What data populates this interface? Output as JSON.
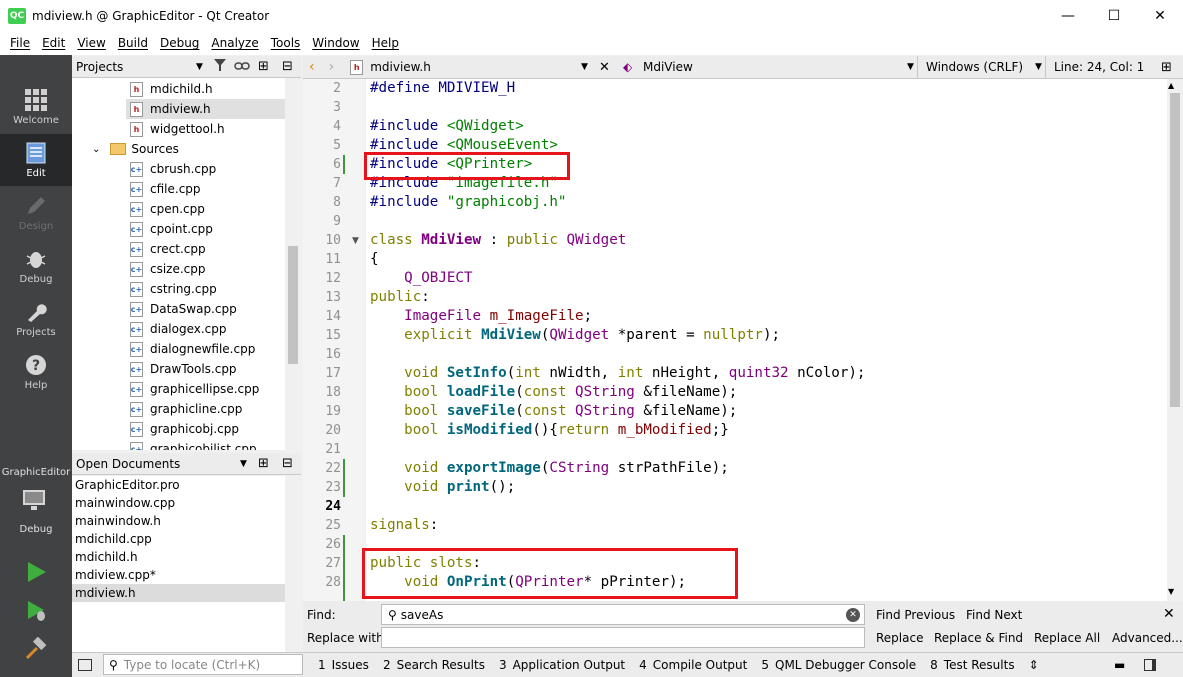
{
  "window": {
    "title": "mdiview.h @ GraphicEditor - Qt Creator",
    "logo": "QC",
    "minimize": "—",
    "maximize": "☐",
    "close": "✕"
  },
  "menu": [
    "File",
    "Edit",
    "View",
    "Build",
    "Debug",
    "Analyze",
    "Tools",
    "Window",
    "Help"
  ],
  "modes": [
    {
      "label": "Welcome",
      "icon": "grid-icon"
    },
    {
      "label": "Edit",
      "icon": "document-icon"
    },
    {
      "label": "Design",
      "icon": "pencil-icon"
    },
    {
      "label": "Debug",
      "icon": "bug-icon"
    },
    {
      "label": "Projects",
      "icon": "wrench-icon"
    },
    {
      "label": "Help",
      "icon": "help-icon"
    }
  ],
  "sidebar": {
    "project_name": "GraphicEditor",
    "project_sub": "Debug"
  },
  "projects": {
    "header": "Projects",
    "tree": [
      {
        "name": "mdichild.h",
        "type": "h"
      },
      {
        "name": "mdiview.h",
        "type": "h",
        "selected": true
      },
      {
        "name": "widgettool.h",
        "type": "h"
      },
      {
        "name": "Sources",
        "type": "folder"
      },
      {
        "name": "cbrush.cpp",
        "type": "cpp"
      },
      {
        "name": "cfile.cpp",
        "type": "cpp"
      },
      {
        "name": "cpen.cpp",
        "type": "cpp"
      },
      {
        "name": "cpoint.cpp",
        "type": "cpp"
      },
      {
        "name": "crect.cpp",
        "type": "cpp"
      },
      {
        "name": "csize.cpp",
        "type": "cpp"
      },
      {
        "name": "cstring.cpp",
        "type": "cpp"
      },
      {
        "name": "DataSwap.cpp",
        "type": "cpp"
      },
      {
        "name": "dialogex.cpp",
        "type": "cpp"
      },
      {
        "name": "dialognewfile.cpp",
        "type": "cpp"
      },
      {
        "name": "DrawTools.cpp",
        "type": "cpp"
      },
      {
        "name": "graphicellipse.cpp",
        "type": "cpp"
      },
      {
        "name": "graphicline.cpp",
        "type": "cpp"
      },
      {
        "name": "graphicobj.cpp",
        "type": "cpp"
      },
      {
        "name": "graphicobjlist.cpp",
        "type": "cpp"
      }
    ]
  },
  "open_documents": {
    "header": "Open Documents",
    "items": [
      "GraphicEditor.pro",
      "mainwindow.cpp",
      "mainwindow.h",
      "mdichild.cpp",
      "mdichild.h",
      "mdiview.cpp*",
      "mdiview.h"
    ],
    "selected": 6
  },
  "editor": {
    "file": "mdiview.h",
    "symbol": "MdiView",
    "encoding": "Windows (CRLF)",
    "position": "Line: 24, Col: 1",
    "current_line": "24",
    "line_numbers": [
      "2",
      "3",
      "4",
      "5",
      "6",
      "7",
      "8",
      "9",
      "10",
      "11",
      "12",
      "13",
      "14",
      "15",
      "16",
      "17",
      "18",
      "19",
      "20",
      "21",
      "22",
      "23",
      "24",
      "25",
      "26",
      "27",
      "28"
    ]
  },
  "find": {
    "find_label": "Find:",
    "replace_label": "Replace with:",
    "find_value": "saveAs",
    "replace_value": "",
    "find_previous": "Find Previous",
    "find_next": "Find Next",
    "replace": "Replace",
    "replace_find": "Replace & Find",
    "replace_all": "Replace All",
    "advanced": "Advanced..."
  },
  "status": {
    "locate_placeholder": "Type to locate (Ctrl+K)",
    "tabs": [
      {
        "n": "1",
        "label": "Issues"
      },
      {
        "n": "2",
        "label": "Search Results"
      },
      {
        "n": "3",
        "label": "Application Output"
      },
      {
        "n": "4",
        "label": "Compile Output"
      },
      {
        "n": "5",
        "label": "QML Debugger Console"
      },
      {
        "n": "8",
        "label": "Test Results"
      }
    ]
  },
  "colors": {
    "highlight_box": "#e8141c",
    "mode_bar": "#404244",
    "run_green": "#3fae3f"
  }
}
